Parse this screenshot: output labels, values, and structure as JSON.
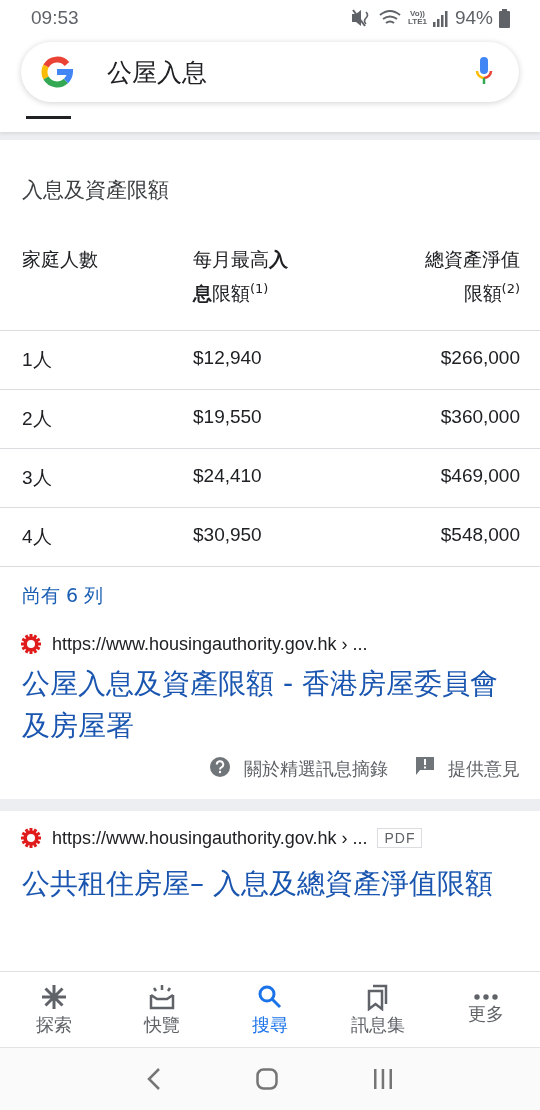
{
  "status_bar": {
    "time": "09:53",
    "battery": "94%",
    "network": "Vo))\nLTE1"
  },
  "search": {
    "query": "公屋入息"
  },
  "snippet": {
    "heading": "入息及資產限額",
    "columns": [
      "家庭人數",
      "每月最高**入息**限額$^{(1)}$",
      "總資產淨值限額$^{(2)}$"
    ],
    "rows": [
      [
        "1人",
        "$12,940",
        "$266,000"
      ],
      [
        "2人",
        "$19,550",
        "$360,000"
      ],
      [
        "3人",
        "$24,410",
        "$469,000"
      ],
      [
        "4人",
        "$30,950",
        "$548,000"
      ]
    ],
    "more_rows": "尚有 6 列",
    "source_url": "https://www.housingauthority.gov.hk › ...",
    "source_title": "公屋入息及資產限額 - 香港房屋委員會及房屋署",
    "actions": [
      "關於精選訊息摘錄",
      "提供意見"
    ]
  },
  "results": [
    {
      "url": "https://www.housingauthority.gov.hk › ...",
      "badge": "PDF",
      "title": "公共租住房屋– 入息及總資產淨值限額"
    }
  ],
  "bottom_nav": [
    {
      "label": "探索",
      "selected": false
    },
    {
      "label": "快覽",
      "selected": false
    },
    {
      "label": "搜尋",
      "selected": true
    },
    {
      "label": "訊息集",
      "selected": false
    },
    {
      "label": "更多",
      "selected": false
    }
  ]
}
